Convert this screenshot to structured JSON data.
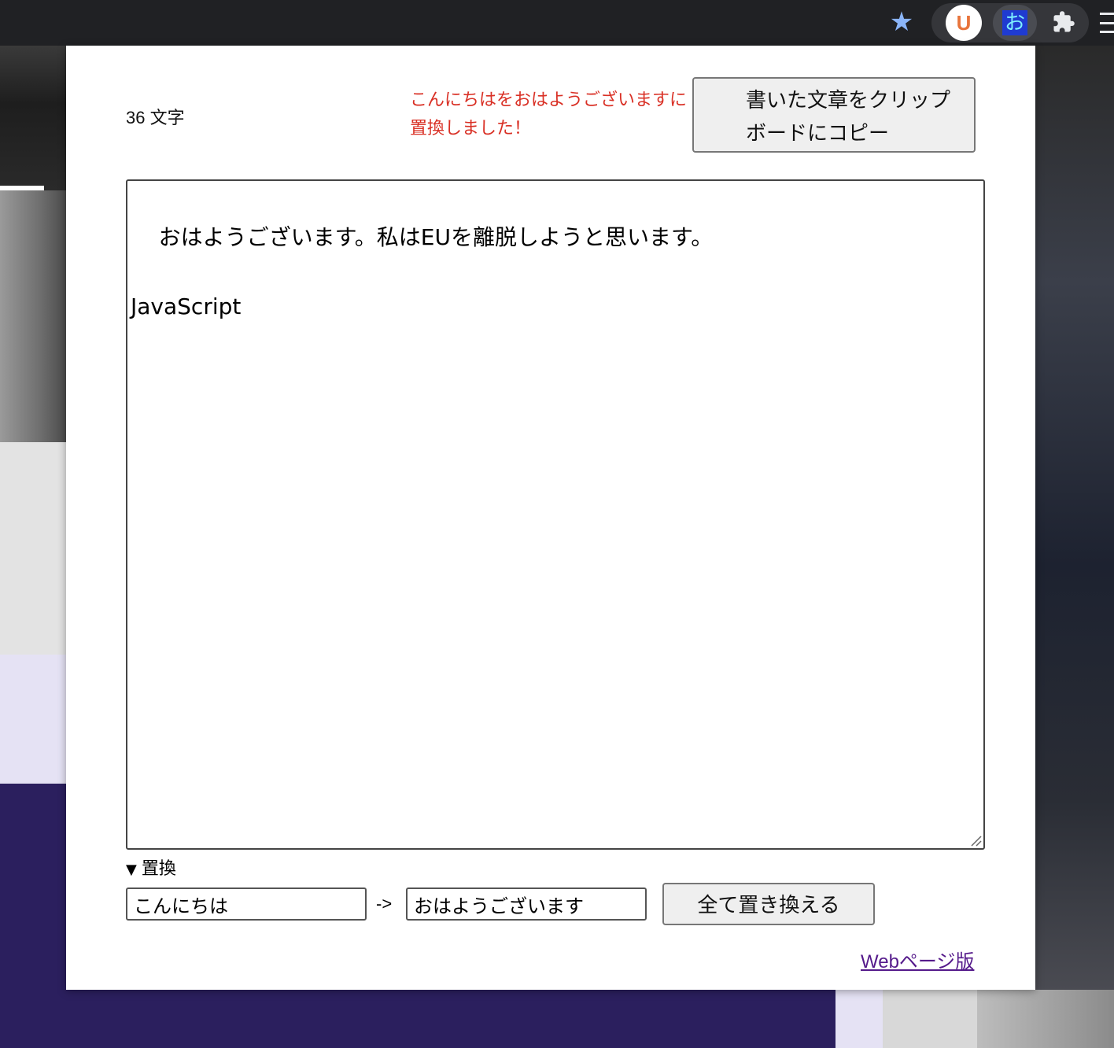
{
  "browser_toolbar": {
    "extension_u_letter": "U",
    "extension_o_glyph": "お",
    "star_icon": "star-icon",
    "puzzle_icon": "puzzle-icon"
  },
  "popup": {
    "char_count": "36 文字",
    "status_message": "こんにちはをおはようございますに置換しました！",
    "copy_button_label": "書いた文章をクリップボードにコピー",
    "editor_text": "おはようございます。私はEUを離脱しようと思います。\n\nJavaScript",
    "replace_section": {
      "summary_label": "置換",
      "find_value": "こんにちは",
      "arrow_label": "->",
      "replace_value": "おはようございます",
      "replace_all_button_label": "全て置き換える"
    },
    "web_link_label": "Webページ版"
  },
  "colors": {
    "status_message": "#d93025",
    "link": "#551a8b",
    "star": "#8ab4f8"
  }
}
